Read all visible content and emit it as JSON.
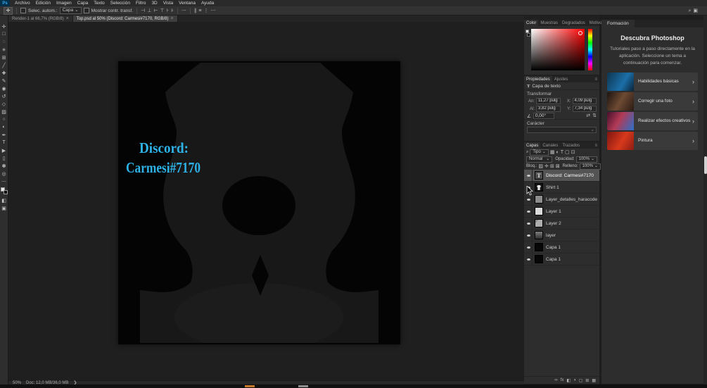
{
  "menu": {
    "logo": "Ps",
    "items": [
      "Archivo",
      "Edición",
      "Imagen",
      "Capa",
      "Texto",
      "Selección",
      "Filtro",
      "3D",
      "Vista",
      "Ventana",
      "Ayuda"
    ]
  },
  "options": {
    "move_tool_glyph": "✛",
    "auto_select_label": "Selec. autom.:",
    "auto_select_value": "Capa",
    "dropdown_arrow": "⌄",
    "show_transform_label": "Mostrar contr. transf.",
    "align_icons": [
      "⊣",
      "⊥",
      "⊢",
      "⊤",
      "⊦",
      "⊧"
    ],
    "more_dots": "⋯",
    "distribute_icons": [
      "∥",
      "≡",
      "⋮",
      "⋯"
    ],
    "search_glyph": "⌕",
    "workspace_glyph": "▣"
  },
  "tabs": [
    {
      "label": "Render-1 al 66,7% (RGB/8)",
      "close": "×"
    },
    {
      "label": "Top.psd al 50% (Discord: Carmesi#7170, RGB/8)",
      "close": "×"
    }
  ],
  "tools": [
    {
      "name": "move",
      "glyph": "✛"
    },
    {
      "name": "marquee",
      "glyph": "□"
    },
    {
      "name": "lasso",
      "glyph": "◌"
    },
    {
      "name": "quick-selection",
      "glyph": "✳"
    },
    {
      "name": "crop",
      "glyph": "⊞"
    },
    {
      "name": "eyedropper",
      "glyph": "╱"
    },
    {
      "name": "healing-brush",
      "glyph": "✚"
    },
    {
      "name": "brush",
      "glyph": "✎"
    },
    {
      "name": "clone-stamp",
      "glyph": "◉"
    },
    {
      "name": "history-brush",
      "glyph": "↺"
    },
    {
      "name": "eraser",
      "glyph": "◇"
    },
    {
      "name": "gradient",
      "glyph": "▨"
    },
    {
      "name": "blur",
      "glyph": "○"
    },
    {
      "name": "dodge",
      "glyph": "◐"
    },
    {
      "name": "pen",
      "glyph": "✒"
    },
    {
      "name": "type",
      "glyph": "T"
    },
    {
      "name": "path-selection",
      "glyph": "▶"
    },
    {
      "name": "shape",
      "glyph": "▯"
    },
    {
      "name": "hand",
      "glyph": "✽"
    },
    {
      "name": "zoom",
      "glyph": "◎"
    },
    {
      "name": "edit-toolbar",
      "glyph": "⋯"
    }
  ],
  "toolbar": {
    "quick_mask_glyph": "◧",
    "screen_mode_glyph": "▣"
  },
  "canvas": {
    "text_line1": "Discord:",
    "text_line2": "Carmesi#7170",
    "text_color": "#2db3e8"
  },
  "color_panel": {
    "tabs": [
      "Color",
      "Muestras",
      "Degradados",
      "Motivos"
    ],
    "menu_glyph": "≡"
  },
  "properties": {
    "tabs": [
      "Propiedades",
      "Ajustes"
    ],
    "type_icon": "T",
    "layer_type": "Capa de texto",
    "transform_title": "Transformar",
    "fields": [
      {
        "label": "An:",
        "value": "11,27 pulg"
      },
      {
        "label": "X:",
        "value": "4,09 pulg"
      },
      {
        "label": "Al:",
        "value": "3,82 pulg"
      },
      {
        "label": "Y:",
        "value": "7,34 pulg"
      }
    ],
    "angle_icon": "∠",
    "angle_value": "0,00°",
    "flip_h_glyph": "⇄",
    "flip_v_glyph": "⇅",
    "character_title": "Carácter"
  },
  "layers": {
    "tabs": [
      "Capas",
      "Canales",
      "Trazados"
    ],
    "search_glyph": "⌕",
    "filter_value": "Tipo",
    "filter_icons": [
      "▦",
      "◐",
      "T",
      "▢",
      "⊡"
    ],
    "blend_mode": "Normal",
    "opacity_label": "Opacidad:",
    "opacity_value": "100%",
    "lock_label": "Bloq.:",
    "lock_icons": [
      "▨",
      "✛",
      "⊞",
      "⊠"
    ],
    "fill_label": "Relleno:",
    "fill_value": "100%",
    "thumb_t_glyph": "T",
    "items": [
      {
        "name": "Discord: Carmesi#7170"
      },
      {
        "name": "Shirt 1"
      },
      {
        "name": "Layer_detalles_haracode"
      },
      {
        "name": "Layer 1"
      },
      {
        "name": "Layer 2"
      },
      {
        "name": "layer"
      },
      {
        "name": "Capa 1"
      },
      {
        "name": "Capa 1"
      }
    ],
    "footer_icons": [
      {
        "name": "link-layers-icon",
        "glyph": "∞"
      },
      {
        "name": "layer-effects-icon",
        "glyph": "fx"
      },
      {
        "name": "layer-mask-icon",
        "glyph": "◧"
      },
      {
        "name": "adjustment-layer-icon",
        "glyph": "◑"
      },
      {
        "name": "layer-group-icon",
        "glyph": "▢"
      },
      {
        "name": "new-layer-icon",
        "glyph": "⊞"
      },
      {
        "name": "delete-layer-icon",
        "glyph": "▦"
      }
    ]
  },
  "learn": {
    "tab": "Formación",
    "title": "Descubra Photoshop",
    "description": "Tutoriales paso a paso directamente en la aplicación. Seleccione un tema a continuación para comenzar.",
    "chevron": "›",
    "cards": [
      {
        "title": "Habilidades básicas"
      },
      {
        "title": "Corregir una foto"
      },
      {
        "title": "Realizar efectos creativos"
      },
      {
        "title": "Pintura"
      }
    ]
  },
  "status": {
    "zoom": "50%",
    "doc_info": "Doc: 12,0 MB/36,0 MB",
    "arrow": "❯"
  }
}
